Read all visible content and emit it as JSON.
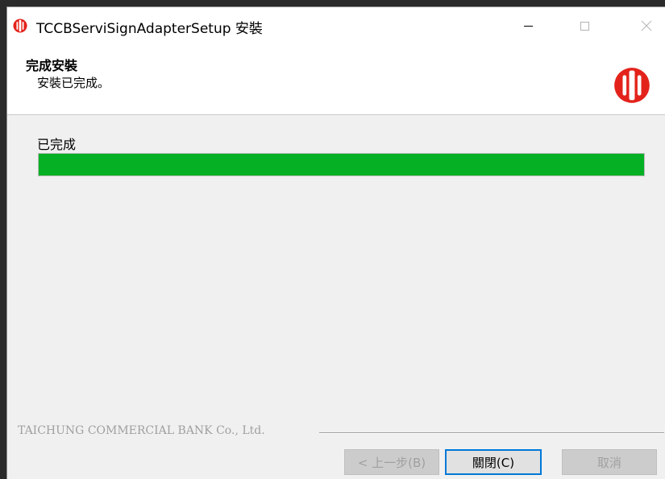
{
  "window": {
    "title": "TCCBServiSignAdapterSetup 安裝",
    "icon": "tccb-logo-icon"
  },
  "header": {
    "title": "完成安裝",
    "subtitle": "安裝已完成。",
    "logo": "tccb-logo-icon"
  },
  "progress": {
    "label": "已完成",
    "value": 1.0,
    "color": "#06b025"
  },
  "footer": {
    "brand": "TAICHUNG COMMERCIAL BANK Co., Ltd."
  },
  "buttons": {
    "back_label": "< 上一步(B)",
    "close_label": "關閉(C)",
    "cancel_label": "取消"
  },
  "colors": {
    "accent": "#0078d7",
    "logo_red": "#e3231b"
  }
}
